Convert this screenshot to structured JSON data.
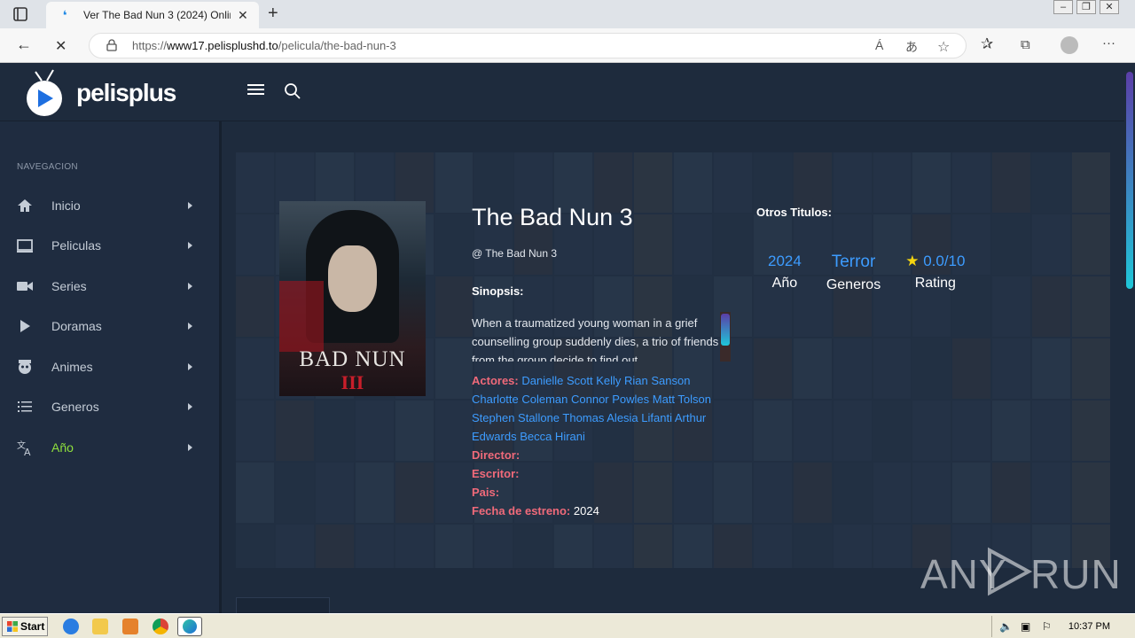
{
  "browser": {
    "tab_title": "Ver The Bad Nun 3 (2024) Onlin",
    "tab_close": "✕",
    "new_tab": "+",
    "url_scheme_host_prefix": "https://",
    "url_host": "www17.pelisplushd.to",
    "url_path": "/pelicula/the-bad-nun-3",
    "read_aloud": "Á",
    "translate": "あ",
    "back": "←",
    "reload": "✕",
    "favorites": "☆",
    "collections": "⧉",
    "more": "···"
  },
  "site": {
    "logo_text": "pelisplus",
    "sidebar": {
      "caption": "NAVEGACION",
      "items": [
        {
          "label": "Inicio",
          "icon": "home-icon"
        },
        {
          "label": "Peliculas",
          "icon": "monitor-icon"
        },
        {
          "label": "Series",
          "icon": "video-camera-icon"
        },
        {
          "label": "Doramas",
          "icon": "play-icon"
        },
        {
          "label": "Animes",
          "icon": "anime-icon"
        },
        {
          "label": "Generos",
          "icon": "list-icon"
        },
        {
          "label": "Año",
          "icon": "translate-icon"
        }
      ],
      "active_color": "#8fe03d"
    },
    "movie": {
      "title": "The Bad Nun 3",
      "original_title": "@ The Bad Nun 3",
      "synopsis_heading": "Sinopsis:",
      "synopsis": "When a traumatized young woman in a grief counselling group suddenly dies, a trio of friends from the group decide to find out",
      "poster_title": "BAD NUN",
      "poster_number": "III",
      "actors_label": "Actores:",
      "actors": "Danielle Scott Kelly Rian Sanson Charlotte Coleman Connor Powles Matt Tolson Stephen Stallone Thomas Alesia Lifanti Arthur Edwards Becca Hirani",
      "director_label": "Director:",
      "writer_label": "Escritor:",
      "country_label": "Pais:",
      "release_label": "Fecha de estreno:",
      "release_value": "2024",
      "other_titles_label": "Otros Titulos:",
      "stats": [
        {
          "value": "2024",
          "label": "Año"
        },
        {
          "value": "Terror",
          "label": "Generos"
        },
        {
          "value": "0.0/10",
          "label": "Rating",
          "star": "★"
        }
      ]
    },
    "watermark": "ANY RUN"
  },
  "taskbar": {
    "start_label": "Start",
    "clock": "10:37 PM"
  },
  "colors": {
    "accent_link": "#3d9cff",
    "label_red": "#f06a7a",
    "bg": "#1e2b3d"
  }
}
